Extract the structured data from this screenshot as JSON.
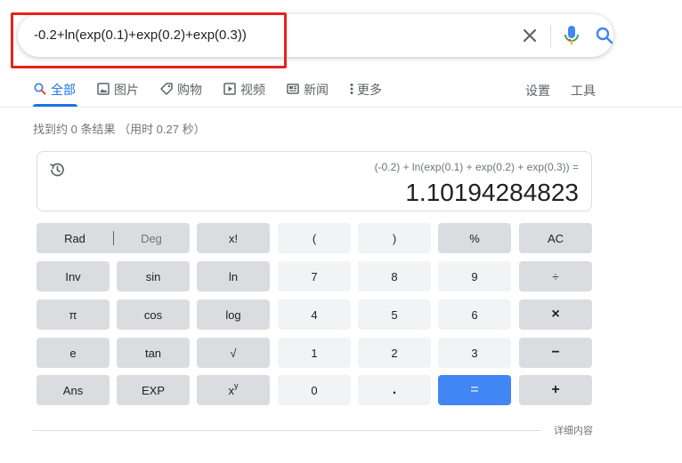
{
  "search": {
    "query": "-0.2+ln(exp(0.1)+exp(0.2)+exp(0.3))"
  },
  "tabs": [
    {
      "label": "全部",
      "icon": "search-icon",
      "active": true
    },
    {
      "label": "图片",
      "icon": "image-icon"
    },
    {
      "label": "购物",
      "icon": "tag-icon"
    },
    {
      "label": "视频",
      "icon": "play-icon"
    },
    {
      "label": "新闻",
      "icon": "newspaper-icon"
    },
    {
      "label": "更多",
      "icon": "more-vert-icon"
    }
  ],
  "tools": {
    "settings": "设置",
    "tools": "工具"
  },
  "result_stats": "找到约 0 条结果 （用时 0.27 秒）",
  "calculator": {
    "expression": "(-0.2) + ln(exp(0.1) + exp(0.2) + exp(0.3)) =",
    "result": "1.10194284823",
    "keys": {
      "rad": "Rad",
      "deg": "Deg",
      "fact": "x!",
      "lparen": "(",
      "rparen": ")",
      "percent": "%",
      "ac": "AC",
      "inv": "Inv",
      "sin": "sin",
      "ln": "ln",
      "seven": "7",
      "eight": "8",
      "nine": "9",
      "divide": "÷",
      "pi": "π",
      "cos": "cos",
      "log": "log",
      "four": "4",
      "five": "5",
      "six": "6",
      "multiply": "×",
      "e": "e",
      "tan": "tan",
      "sqrt": "√",
      "one": "1",
      "two": "2",
      "three": "3",
      "minus": "−",
      "ans": "Ans",
      "exp": "EXP",
      "pow_base": "x",
      "pow_exp": "y",
      "zero": "0",
      "dot": ".",
      "equals": "=",
      "plus": "+"
    }
  },
  "more_link": "详细内容",
  "colors": {
    "accent": "#1a73e8",
    "equals_key": "#4285f4",
    "highlight_box": "#e8221c"
  }
}
